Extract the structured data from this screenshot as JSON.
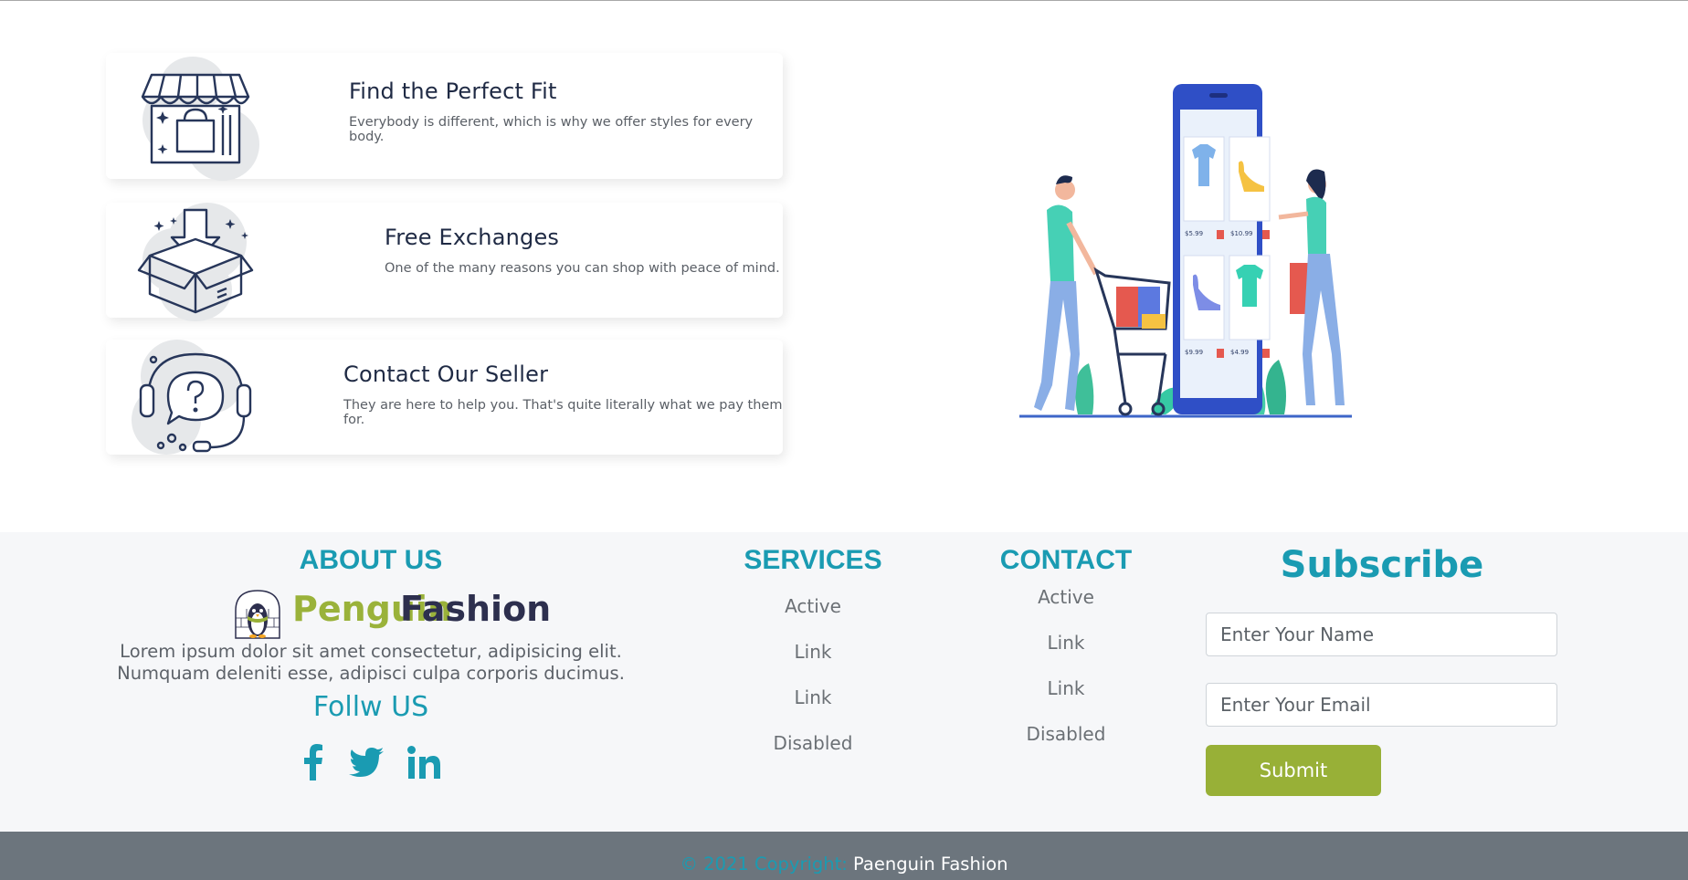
{
  "features": [
    {
      "title": "Find the Perfect Fit",
      "description": "Everybody is different, which is why we offer styles for every body.",
      "icon": "shop-bag-icon"
    },
    {
      "title": "Free Exchanges",
      "description": "One of the many reasons you can shop with peace of mind.",
      "icon": "open-box-icon"
    },
    {
      "title": "Contact Our Seller",
      "description": "They are here to help you. That's quite literally what we pay them for.",
      "icon": "headset-support-icon"
    }
  ],
  "illustration": {
    "prices": [
      "$5.99",
      "$10.99",
      "$9.99",
      "$4.99"
    ]
  },
  "footer": {
    "about": {
      "heading": "ABOUT US",
      "brand_first": "Penguin",
      "brand_second": "Fashion",
      "text": "Lorem ipsum dolor sit amet consectetur, adipisicing elit. Numquam deleniti esse, adipisci culpa corporis ducimus.",
      "follow_heading": "Follw US",
      "social": [
        "facebook-icon",
        "twitter-icon",
        "linkedin-icon"
      ]
    },
    "services": {
      "heading": "SERVICES",
      "links": [
        "Active",
        "Link",
        "Link",
        "Disabled"
      ]
    },
    "contact": {
      "heading": "CONTACT",
      "links": [
        "Active",
        "Link",
        "Link",
        "Disabled"
      ]
    },
    "subscribe": {
      "heading": "Subscribe",
      "name_placeholder": "Enter Your Name",
      "email_placeholder": "Enter Your Email",
      "submit_label": "Submit"
    }
  },
  "copyright": {
    "prefix": "© 2021 Copyright:",
    "brand": "Paenguin Fashion"
  },
  "colors": {
    "accent": "#1a9bb2",
    "brand_green": "#98b037",
    "brand_dark": "#2d2f4e",
    "copyright_bg": "#6c757d"
  }
}
